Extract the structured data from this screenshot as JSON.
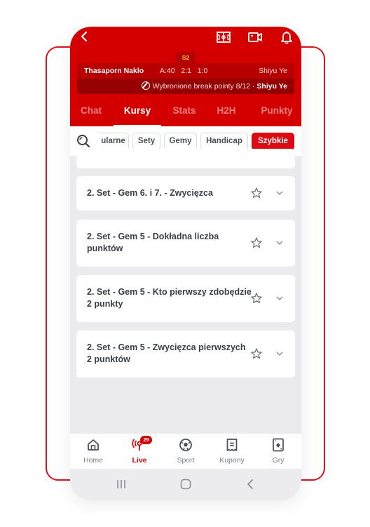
{
  "header": {
    "back_label": "‹",
    "icons": [
      "pitch-icon",
      "video-icon",
      "bell-icon"
    ]
  },
  "match": {
    "set_badge": "S2",
    "player1": "Thasaporn Naklo",
    "score": "A:40   2:1   1:0",
    "player2": "Shiyu Ye",
    "stat_text": "Wybronione break pointy 8/12 · ",
    "stat_player": "Shiyu Ye"
  },
  "tabs": [
    {
      "label": "Chat",
      "active": false
    },
    {
      "label": "Kursy",
      "active": true
    },
    {
      "label": "Stats",
      "active": false
    },
    {
      "label": "H2H",
      "active": false
    },
    {
      "label": "Punkty",
      "active": false
    }
  ],
  "filters": [
    {
      "label": "ularne",
      "active": false
    },
    {
      "label": "Sety",
      "active": false
    },
    {
      "label": "Gemy",
      "active": false
    },
    {
      "label": "Handicap",
      "active": false
    },
    {
      "label": "Szybkie",
      "active": true
    }
  ],
  "markets": [
    {
      "title": "2. Set -  Gem 6. i 7. - Zwycięzca"
    },
    {
      "title": "2. Set - Gem 5 - Dokładna liczba punktów"
    },
    {
      "title": "2. Set - Gem 5  - Kto pierwszy zdobędzie 2 punkty"
    },
    {
      "title": "2. Set - Gem 5  - Zwycięzca pierwszych 2 punktów"
    }
  ],
  "bottom_nav": [
    {
      "label": "Home",
      "icon": "home-icon",
      "active": false
    },
    {
      "label": "Live",
      "icon": "live-icon",
      "active": true,
      "badge": "29"
    },
    {
      "label": "Sport",
      "icon": "soccer-ball-icon",
      "active": false
    },
    {
      "label": "Kupony",
      "icon": "receipt-icon",
      "active": false
    },
    {
      "label": "Gry",
      "icon": "cards-icon",
      "active": false
    }
  ],
  "colors": {
    "brand_red": "#d40000",
    "active_chip": "#dc0a12",
    "set_badge_text": "#ffcc33"
  }
}
